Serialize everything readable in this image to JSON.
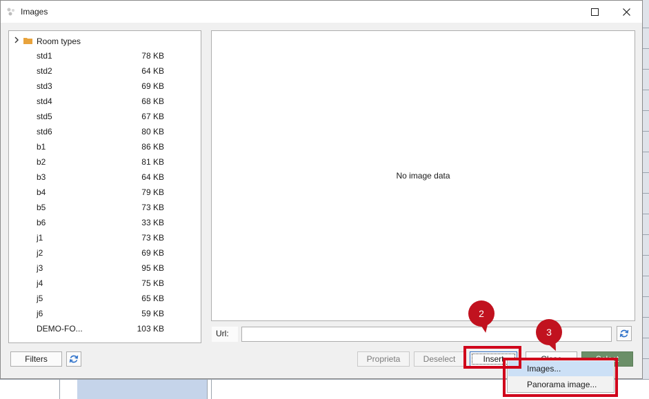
{
  "window": {
    "title": "Images"
  },
  "tree": {
    "root_label": "Room types",
    "items": [
      {
        "name": "std1",
        "size": "78 KB"
      },
      {
        "name": "std2",
        "size": "64 KB"
      },
      {
        "name": "std3",
        "size": "69 KB"
      },
      {
        "name": "std4",
        "size": "68 KB"
      },
      {
        "name": "std5",
        "size": "67 KB"
      },
      {
        "name": "std6",
        "size": "80 KB"
      },
      {
        "name": "b1",
        "size": "86 KB"
      },
      {
        "name": "b2",
        "size": "81 KB"
      },
      {
        "name": "b3",
        "size": "64 KB"
      },
      {
        "name": "b4",
        "size": "79 KB"
      },
      {
        "name": "b5",
        "size": "73 KB"
      },
      {
        "name": "b6",
        "size": "33 KB"
      },
      {
        "name": "j1",
        "size": "73 KB"
      },
      {
        "name": "j2",
        "size": "69 KB"
      },
      {
        "name": "j3",
        "size": "95 KB"
      },
      {
        "name": "j4",
        "size": "75 KB"
      },
      {
        "name": "j5",
        "size": "65 KB"
      },
      {
        "name": "j6",
        "size": "59 KB"
      },
      {
        "name": "DEMO-FO...",
        "size": "103 KB"
      }
    ]
  },
  "preview": {
    "empty_text": "No image data"
  },
  "url": {
    "label": "Url:",
    "value": ""
  },
  "buttons": {
    "filters": "Filters",
    "proprieta": "Proprieta",
    "deselect": "Deselect",
    "insert": "Insert",
    "close": "Close",
    "select": "Select"
  },
  "insert_menu": {
    "items": [
      "Images...",
      "Panorama image..."
    ]
  },
  "annotations": {
    "marker_2": "2",
    "marker_3": "3"
  },
  "colors": {
    "highlight": "#d0021b",
    "marker": "#c1121f",
    "select_button": "#6b8f68",
    "folder": "#e8a33c"
  }
}
